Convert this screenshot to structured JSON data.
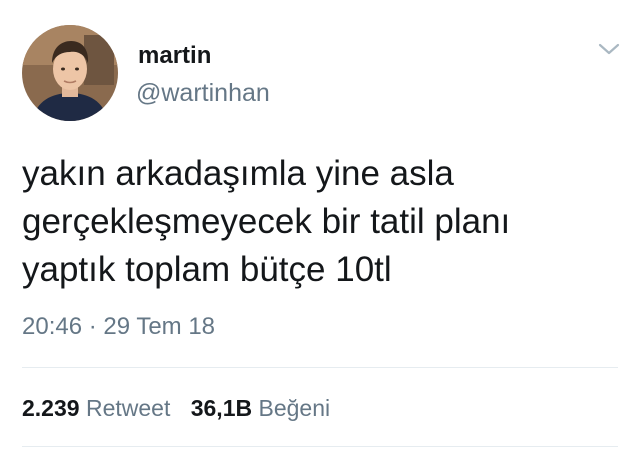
{
  "user": {
    "display_name": "martin",
    "handle": "@wartinhan"
  },
  "tweet": {
    "lines": [
      "yakın arkadaşımla yine asla",
      "gerçekleşmeyecek bir tatil planı",
      "yaptık toplam bütçe 10tl"
    ],
    "timestamp": "20:46 · 29 Tem 18"
  },
  "stats": {
    "retweet_count": "2.239",
    "retweet_label": "Retweet",
    "like_count": "36,1B",
    "like_label": "Beğeni"
  },
  "icons": {
    "menu": "chevron-down-icon"
  }
}
